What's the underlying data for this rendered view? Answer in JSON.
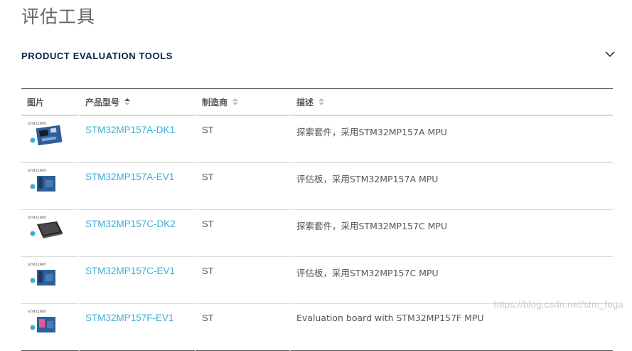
{
  "page": {
    "title": "评估工具",
    "watermark": "https://blog.csdn.net/stm_foga"
  },
  "section": {
    "title": "PRODUCT EVALUATION TOOLS",
    "toggle_icon": "chevron-down-icon"
  },
  "table": {
    "headers": [
      {
        "label": "图片",
        "sortable": false
      },
      {
        "label": "产品型号",
        "sortable": true,
        "sort_state": "active"
      },
      {
        "label": "制造商",
        "sortable": true,
        "sort_state": "none"
      },
      {
        "label": "描述",
        "sortable": true,
        "sort_state": "none"
      }
    ],
    "rows": [
      {
        "thumb_label": "STM32MP1",
        "board": "dk-blue",
        "part": "STM32MP157A-DK1",
        "maker": "ST",
        "desc": "探索套件，采用STM32MP157A MPU"
      },
      {
        "thumb_label": "STM32MP1",
        "board": "ev-blue",
        "part": "STM32MP157A-EV1",
        "maker": "ST",
        "desc": "评估板，采用STM32MP157A MPU"
      },
      {
        "thumb_label": "STM32MP1",
        "board": "dk-screen",
        "part": "STM32MP157C-DK2",
        "maker": "ST",
        "desc": "探索套件，采用STM32MP157C MPU"
      },
      {
        "thumb_label": "STM32MP1",
        "board": "ev-blue",
        "part": "STM32MP157C-EV1",
        "maker": "ST",
        "desc": "评估板，采用STM32MP157C MPU"
      },
      {
        "thumb_label": "STM32MP1",
        "board": "ev-pink",
        "part": "STM32MP157F-EV1",
        "maker": "ST",
        "desc": "Evaluation board with STM32MP157F MPU"
      }
    ]
  },
  "colors": {
    "link": "#3caed5",
    "section_title": "#03234b",
    "board_blue": "#2f5f9a",
    "board_dark": "#2a2a2a",
    "st_logo": "#3caed5"
  }
}
